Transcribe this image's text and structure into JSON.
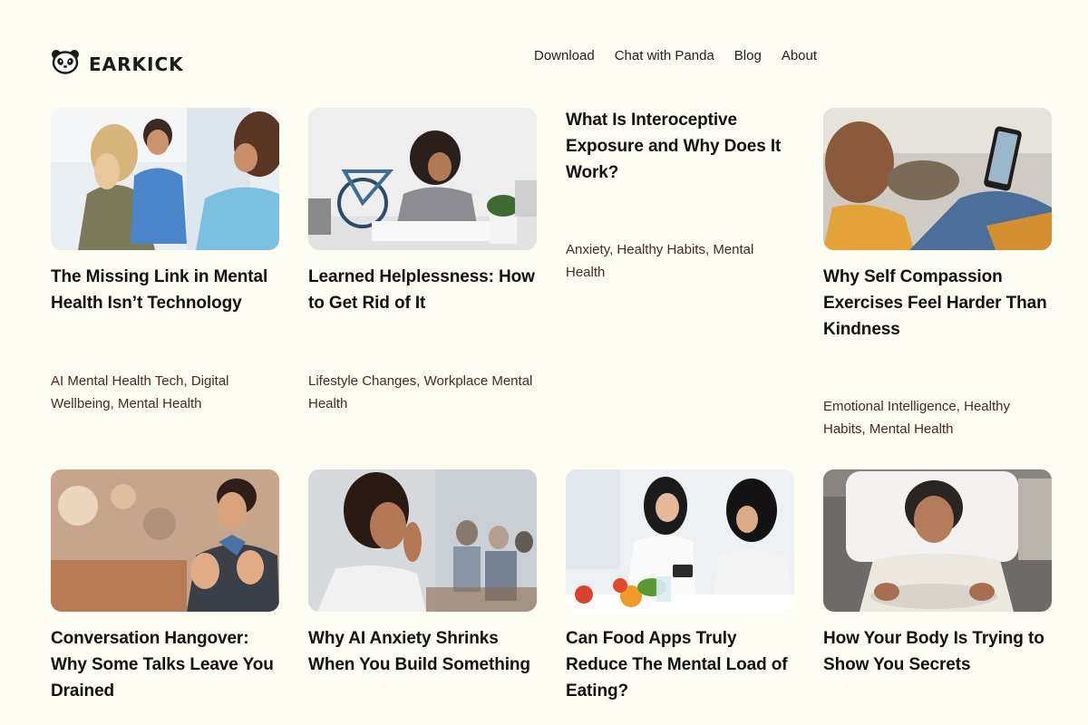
{
  "brand": {
    "name": "EARKICK",
    "logo_icon": "panda-icon"
  },
  "nav": [
    {
      "label": "Download"
    },
    {
      "label": "Chat with Panda"
    },
    {
      "label": "Blog"
    },
    {
      "label": "About"
    }
  ],
  "posts": [
    {
      "title": "The Missing Link in Mental Health Isn’t Technology",
      "tags": [
        "AI Mental Health Tech",
        "Digital Wellbeing",
        "Mental Health"
      ],
      "image": "therapy-session-photo"
    },
    {
      "title": "Learned Helplessness: How to Get Rid of It",
      "tags": [
        "Lifestyle Changes",
        "Workplace Mental Health"
      ],
      "image": "stressed-woman-at-desk-photo"
    },
    {
      "title": "What Is Interoceptive Exposure and Why Does It Work?",
      "tags": [
        "Anxiety",
        "Healthy Habits",
        "Mental Health"
      ],
      "image": ""
    },
    {
      "title": "Why Self Compassion Exercises Feel Harder Than Kindness",
      "tags": [
        "Emotional Intelligence",
        "Healthy Habits",
        "Mental Health"
      ],
      "image": "woman-with-cat-video-call-photo"
    },
    {
      "title": "Conversation Hangover: Why Some Talks Leave You Drained",
      "tags": [],
      "image": "man-raising-hands-photo"
    },
    {
      "title": "Why AI Anxiety Shrinks When You Build Something",
      "tags": [],
      "image": "anxious-woman-office-photo"
    },
    {
      "title": "Can Food Apps Truly Reduce The Mental Load of Eating?",
      "tags": [],
      "image": "nutritionist-with-phone-photo"
    },
    {
      "title": "How Your Body Is Trying to Show You Secrets",
      "tags": [],
      "image": "woman-lying-in-bed-photo"
    }
  ]
}
